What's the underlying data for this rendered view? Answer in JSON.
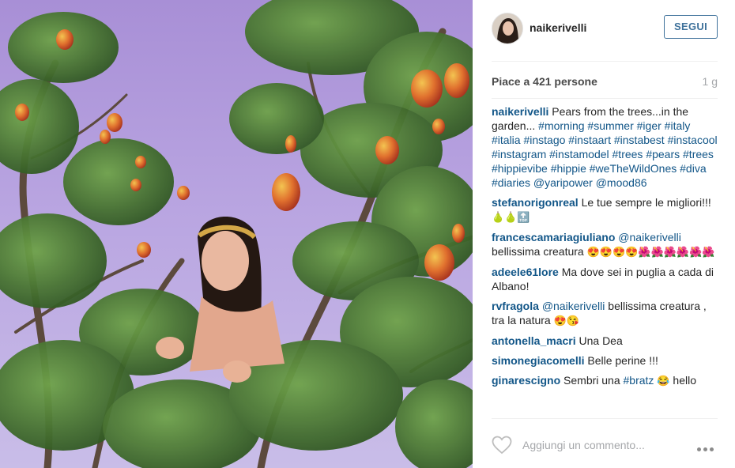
{
  "post": {
    "username": "naikerivelli",
    "follow_label": "SEGUI",
    "likes_text": "Piace a 421 persone",
    "time_ago": "1 g",
    "add_comment_placeholder": "Aggiungi un commento...",
    "photo_icon": "photo-pears-tree"
  },
  "caption": {
    "user": "naikerivelli",
    "text": "Pears from the trees...in the garden...",
    "tags": "#morning #summer #iger #italy #italia #instago #instaart #instabest #instacool #instagram #instamodel #trees #pears #trees #hippievibe #hippie #weTheWildOnes #diva #diaries @yaripower @mood86"
  },
  "comments": [
    {
      "user": "stefanorigonreal",
      "text": "Le tue sempre le migliori!!!",
      "emoji": "🍐🍐🔝"
    },
    {
      "user": "francescamariagiuliano",
      "mention": "@naikerivelli",
      "text": "bellissima creatura",
      "emoji": "😍😍😍😍🌺🌺🌺🌺🌺🌺"
    },
    {
      "user": "adeele61lore",
      "text": "Ma dove sei in puglia a cada di Albano!"
    },
    {
      "user": "rvfragola",
      "mention": "@naikerivelli",
      "text": "bellissima creatura , tra la natura",
      "emoji": "😍😘"
    },
    {
      "user": "antonella_macri",
      "text": "Una Dea"
    },
    {
      "user": "simonegiacomelli",
      "text": "Belle perine !!!"
    },
    {
      "user": "ginarescigno",
      "text": "Sembri una",
      "tag": "#bratz",
      "emoji": "😂",
      "text2": "hello"
    }
  ],
  "colors": {
    "link": "#125688",
    "follow": "#3f729b",
    "sky": "#b9a5e1",
    "leaf": "#3d6b2a",
    "pear": "#d9532c"
  }
}
